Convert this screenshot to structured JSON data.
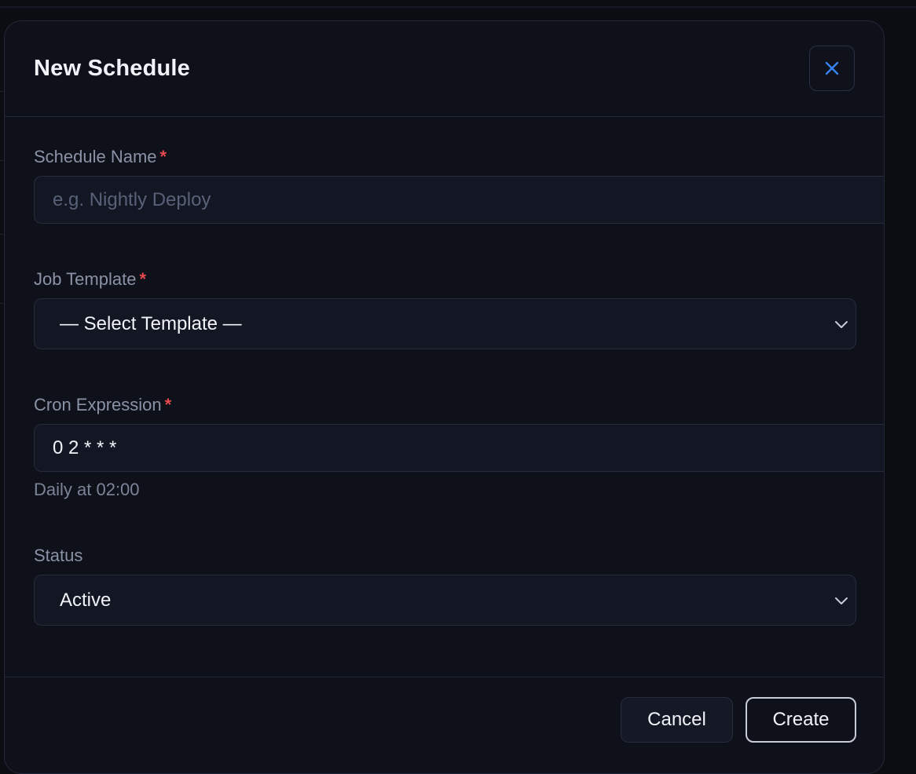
{
  "dialog": {
    "title": "New Schedule",
    "close_icon": "close-icon",
    "accent_color": "#3b82f6",
    "required_color": "#e5484d"
  },
  "form": {
    "schedule_name": {
      "label": "Schedule Name",
      "required_mark": "*",
      "value": "",
      "placeholder": "e.g. Nightly Deploy"
    },
    "job_template": {
      "label": "Job Template",
      "required_mark": "*",
      "selected": "— Select Template —",
      "icon": "chevron-down-icon"
    },
    "cron_expression": {
      "label": "Cron Expression",
      "required_mark": "*",
      "value": "0 2 * * *",
      "hint": "Daily at 02:00"
    },
    "status": {
      "label": "Status",
      "selected": "Active",
      "icon": "chevron-down-icon"
    }
  },
  "footer": {
    "cancel_label": "Cancel",
    "create_label": "Create"
  }
}
